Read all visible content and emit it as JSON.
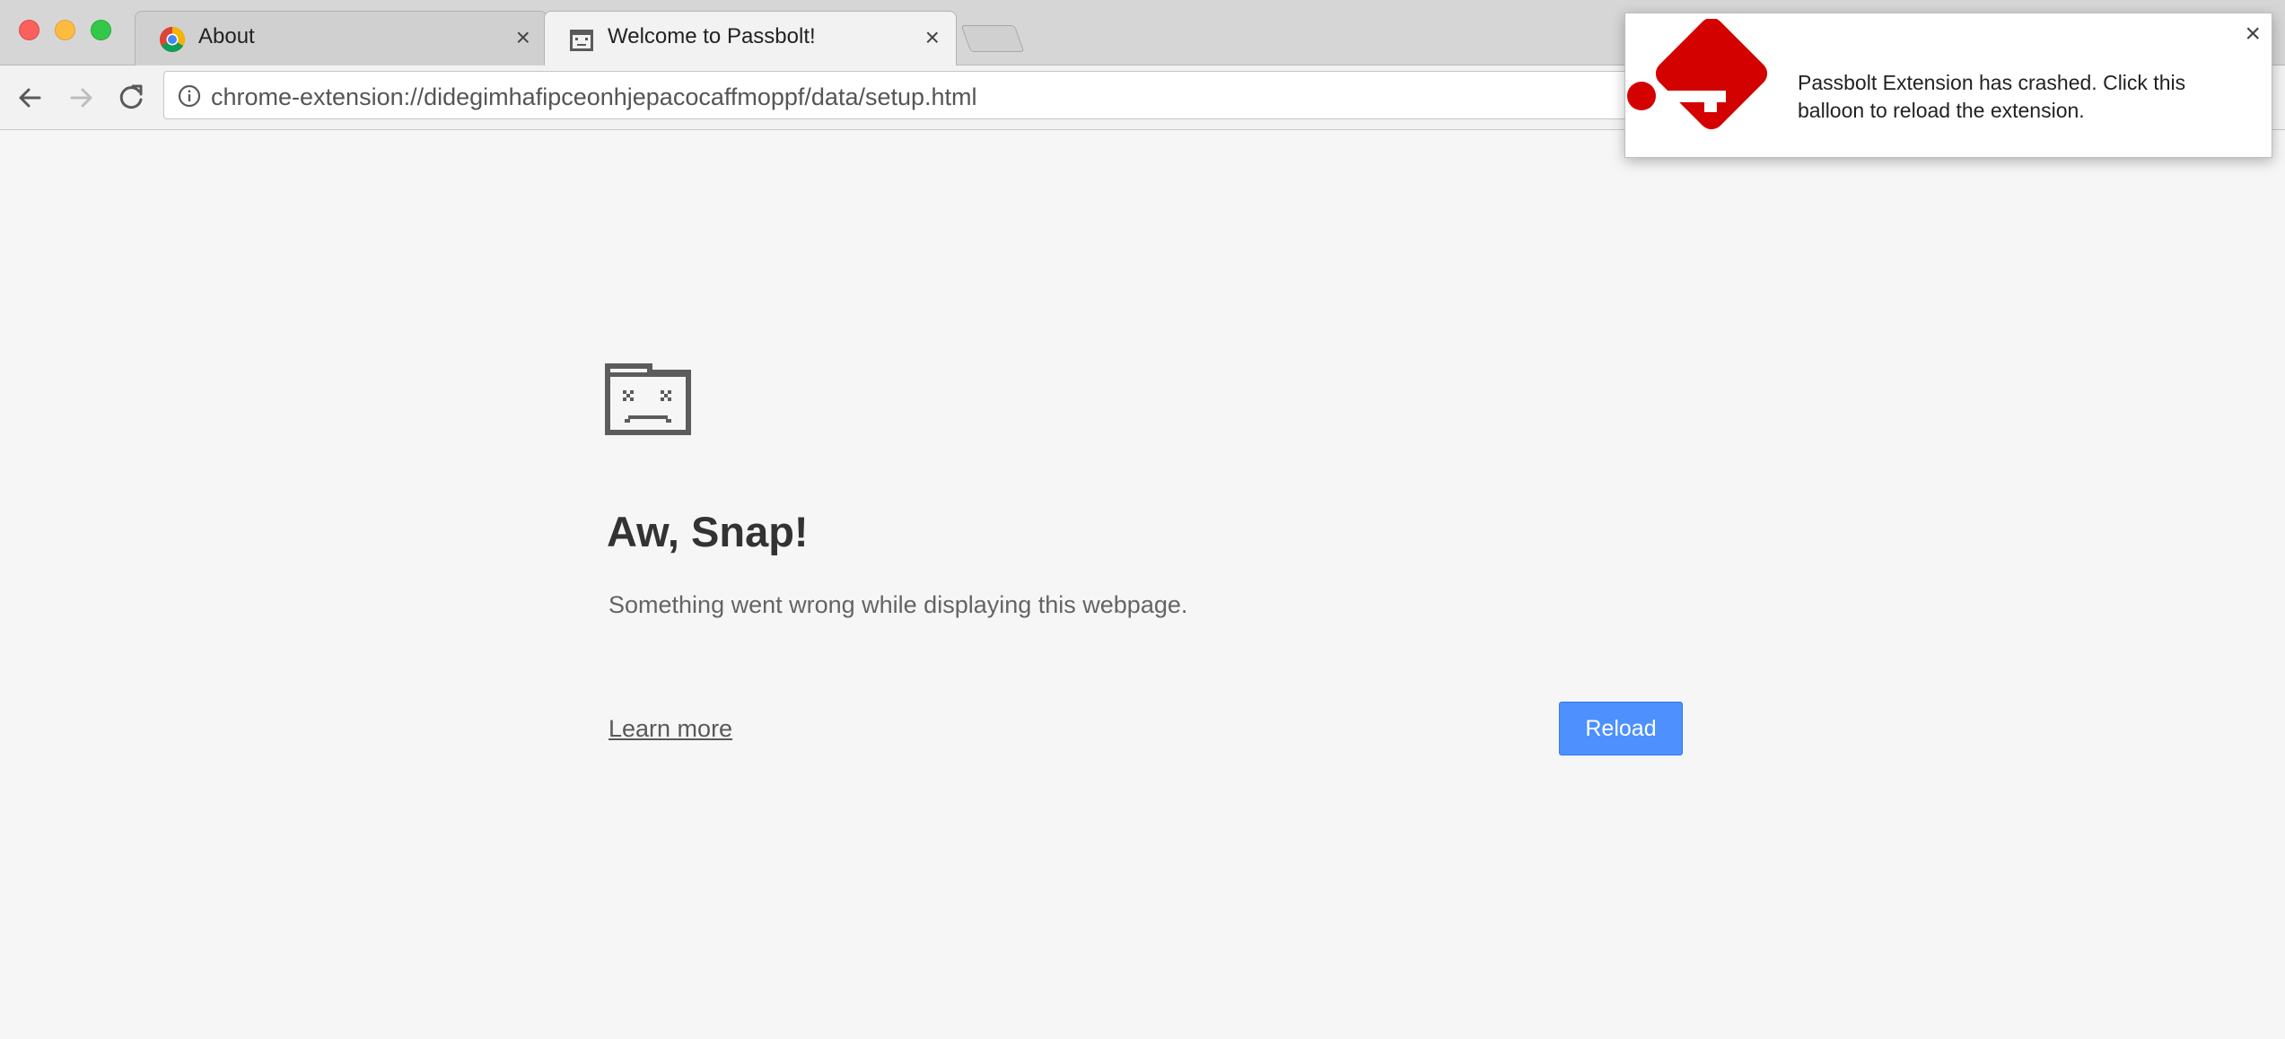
{
  "browser": {
    "tabs": [
      {
        "label": "About",
        "close": "×"
      },
      {
        "label": "Welcome to Passbolt!",
        "close": "×"
      }
    ],
    "address": {
      "url": "chrome-extension://didegimhafipceonhjepacocaffmoppf/data/setup.html"
    }
  },
  "error_page": {
    "heading": "Aw, Snap!",
    "message": "Something went wrong while displaying this webpage.",
    "learn_more": "Learn more",
    "reload": "Reload"
  },
  "notification": {
    "message": "Passbolt Extension has crashed. Click this balloon to reload the extension.",
    "close": "×"
  },
  "colors": {
    "accent": "#4d90fe",
    "passbolt_red": "#d40101"
  },
  "icons": {
    "chrome": "chrome-logo-icon",
    "sad_tab": "sad-tab-icon",
    "passbolt": "passbolt-key-logo"
  }
}
